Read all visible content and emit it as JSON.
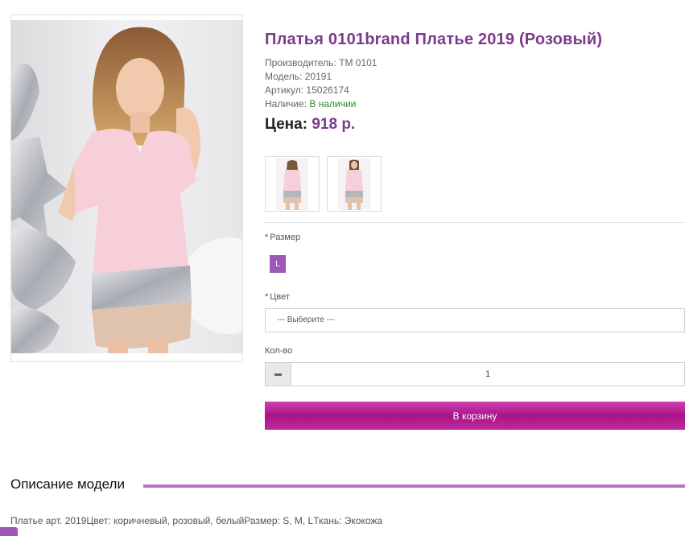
{
  "product": {
    "title": "Платья 0101brand Платье 2019 (Розовый)",
    "manufacturer_label": "Производитель:",
    "manufacturer": "TM 0101",
    "model_label": "Модель:",
    "model": "20191",
    "sku_label": "Артикул:",
    "sku": "15026174",
    "stock_label": "Наличие:",
    "stock": "В наличии",
    "price_label": "Цена:",
    "price": "918 р."
  },
  "options": {
    "size_label": "Размер",
    "size_value": "L",
    "color_label": "Цвет",
    "color_placeholder": "--- Выберите ---",
    "qty_label": "Кол-во",
    "qty_value": "1",
    "required_mark": "*"
  },
  "actions": {
    "add_to_cart": "В корзину"
  },
  "description": {
    "heading": "Описание модели",
    "text": "Платье арт. 2019Цвет: коричневый, розовый, белыйРазмер: S, M, LТкань: Экокожа"
  },
  "colors": {
    "accent": "#7b3a8c",
    "button": "#b41c92",
    "chip": "#9c57b8",
    "stock": "#2c8a2c"
  }
}
